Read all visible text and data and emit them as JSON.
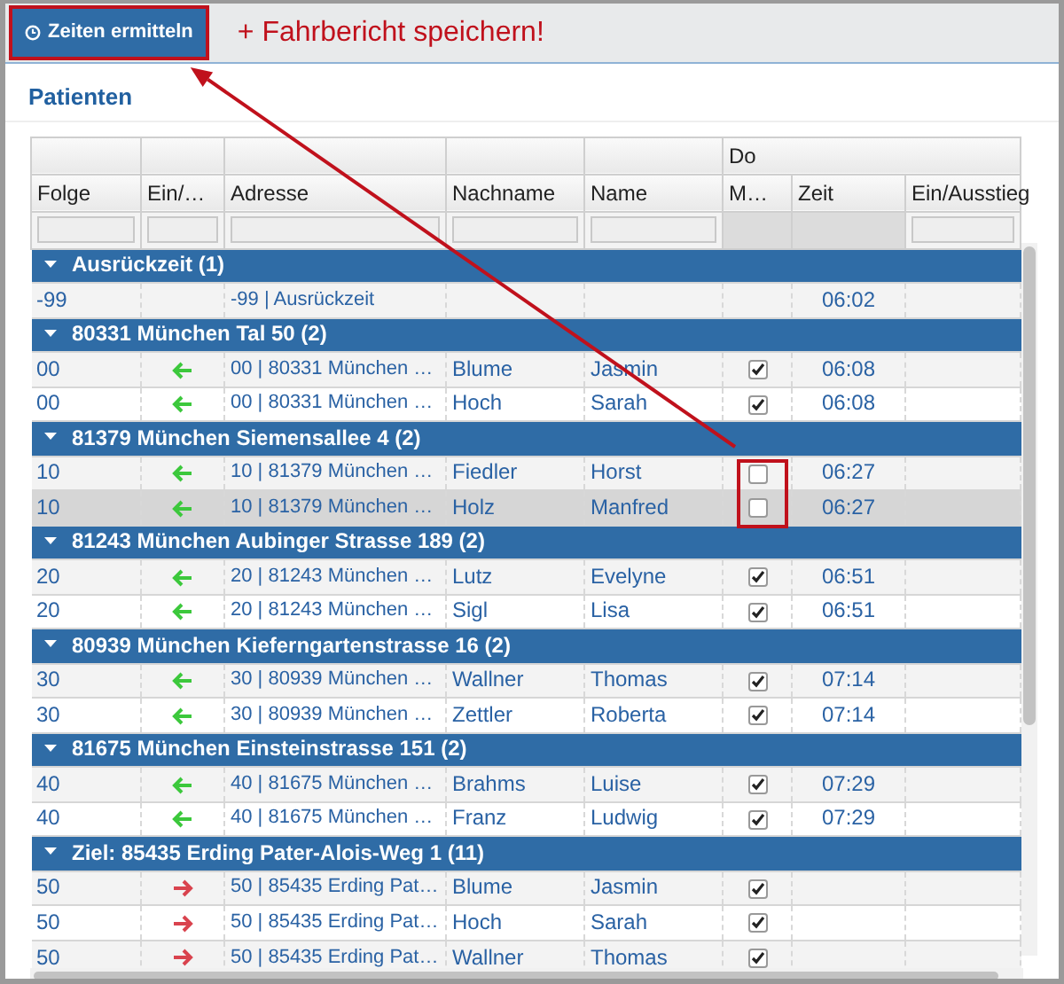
{
  "toolbar": {
    "button": {
      "label": "Zeiten ermitteln",
      "highlighted": true
    },
    "annotation": "+ Fahrbericht speichern!"
  },
  "panel": {
    "title": "Patienten"
  },
  "table": {
    "group_header": "Do",
    "columns": [
      {
        "label": "Folge",
        "filter": true
      },
      {
        "label": "Ein/…",
        "filter": true
      },
      {
        "label": "Adresse",
        "filter": true
      },
      {
        "label": "Nachname",
        "filter": true
      },
      {
        "label": "Name",
        "filter": true
      },
      {
        "label": "M…",
        "filter": false
      },
      {
        "label": "Zeit",
        "filter": false
      },
      {
        "label": "Ein/Ausstieg",
        "filter": true
      }
    ],
    "groups": [
      {
        "title": "Ausrückzeit (1)",
        "expanded": true,
        "rows": [
          {
            "kind": "depot",
            "folge": "-99",
            "address": "-99 | Ausrückzeit",
            "time": "06:02",
            "selected": false,
            "highlighted": false
          }
        ]
      },
      {
        "title": "80331 München Tal 50 (2)",
        "expanded": true,
        "rows": [
          {
            "kind": "pickup",
            "folge": "00",
            "address": "00 | 80331 München …",
            "nachname": "Blume",
            "name": "Jasmin",
            "checked": true,
            "time": "06:08",
            "selected": false,
            "highlighted": false
          },
          {
            "kind": "pickup",
            "folge": "00",
            "address": "00 | 80331 München …",
            "nachname": "Hoch",
            "name": "Sarah",
            "checked": true,
            "time": "06:08",
            "selected": false,
            "highlighted": false
          }
        ]
      },
      {
        "title": "81379 München Siemensallee 4 (2)",
        "expanded": true,
        "rows": [
          {
            "kind": "pickup",
            "folge": "10",
            "address": "10 | 81379 München …",
            "nachname": "Fiedler",
            "name": "Horst",
            "checked": false,
            "time": "06:27",
            "selected": false,
            "highlighted": true
          },
          {
            "kind": "pickup",
            "folge": "10",
            "address": "10 | 81379 München …",
            "nachname": "Holz",
            "name": "Manfred",
            "checked": false,
            "time": "06:27",
            "selected": true,
            "highlighted": true
          }
        ]
      },
      {
        "title": "81243 München Aubinger Strasse 189 (2)",
        "expanded": true,
        "rows": [
          {
            "kind": "pickup",
            "folge": "20",
            "address": "20 | 81243 München …",
            "nachname": "Lutz",
            "name": "Evelyne",
            "checked": true,
            "time": "06:51",
            "selected": false,
            "highlighted": false
          },
          {
            "kind": "pickup",
            "folge": "20",
            "address": "20 | 81243 München …",
            "nachname": "Sigl",
            "name": "Lisa",
            "checked": true,
            "time": "06:51",
            "selected": false,
            "highlighted": false
          }
        ]
      },
      {
        "title": "80939 München Kieferngartenstrasse 16 (2)",
        "expanded": true,
        "rows": [
          {
            "kind": "pickup",
            "folge": "30",
            "address": "30 | 80939 München …",
            "nachname": "Wallner",
            "name": "Thomas",
            "checked": true,
            "time": "07:14",
            "selected": false,
            "highlighted": false
          },
          {
            "kind": "pickup",
            "folge": "30",
            "address": "30 | 80939 München …",
            "nachname": "Zettler",
            "name": "Roberta",
            "checked": true,
            "time": "07:14",
            "selected": false,
            "highlighted": false
          }
        ]
      },
      {
        "title": "81675 München Einsteinstrasse 151 (2)",
        "expanded": true,
        "rows": [
          {
            "kind": "pickup",
            "folge": "40",
            "address": "40 | 81675 München …",
            "nachname": "Brahms",
            "name": "Luise",
            "checked": true,
            "time": "07:29",
            "selected": false,
            "highlighted": false
          },
          {
            "kind": "pickup",
            "folge": "40",
            "address": "40 | 81675 München …",
            "nachname": "Franz",
            "name": "Ludwig",
            "checked": true,
            "time": "07:29",
            "selected": false,
            "highlighted": false
          }
        ]
      },
      {
        "title": "Ziel: 85435 Erding Pater-Alois-Weg 1 (11)",
        "expanded": true,
        "rows": [
          {
            "kind": "dropoff",
            "folge": "50",
            "address": "50 | 85435 Erding Pat…",
            "nachname": "Blume",
            "name": "Jasmin",
            "checked": true,
            "selected": false,
            "highlighted": false
          },
          {
            "kind": "dropoff",
            "folge": "50",
            "address": "50 | 85435 Erding Pat…",
            "nachname": "Hoch",
            "name": "Sarah",
            "checked": true,
            "selected": false,
            "highlighted": false
          },
          {
            "kind": "dropoff",
            "folge": "50",
            "address": "50 | 85435 Erding Pat…",
            "nachname": "Wallner",
            "name": "Thomas",
            "checked": true,
            "selected": false,
            "highlighted": false
          }
        ]
      }
    ]
  }
}
